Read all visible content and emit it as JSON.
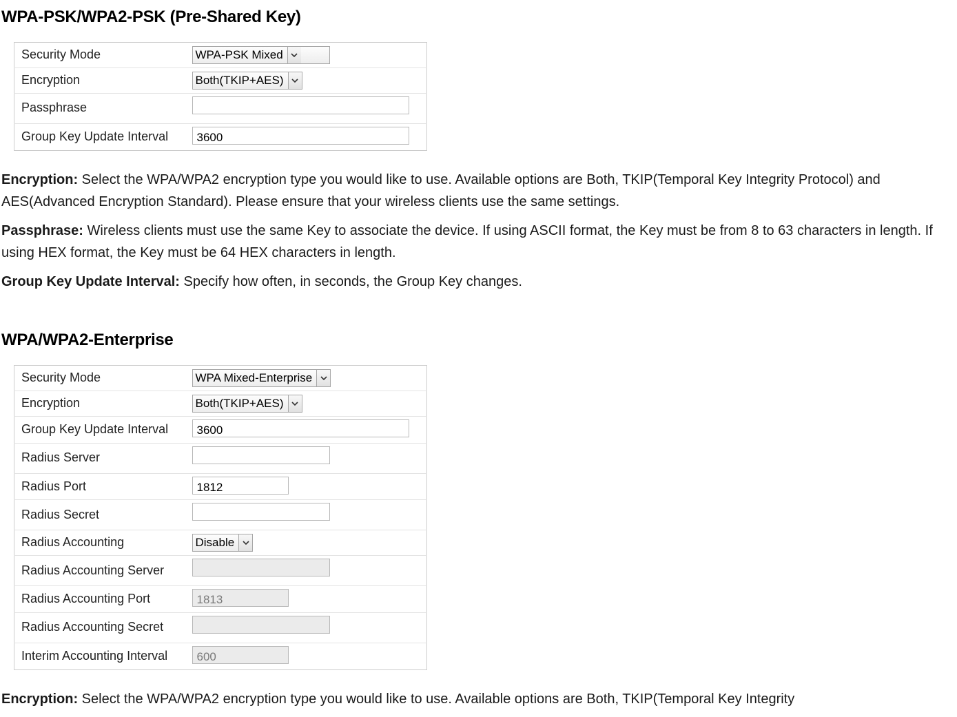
{
  "section1": {
    "heading": "WPA-PSK/WPA2-PSK (Pre-Shared Key)",
    "table": {
      "security_mode": {
        "label": "Security Mode",
        "value": "WPA-PSK Mixed"
      },
      "encryption": {
        "label": "Encryption",
        "value": "Both(TKIP+AES)"
      },
      "passphrase": {
        "label": "Passphrase",
        "value": ""
      },
      "group_key": {
        "label": "Group Key Update Interval",
        "value": "3600"
      }
    },
    "descriptions": {
      "encryption": {
        "term": "Encryption:",
        "text": " Select the WPA/WPA2 encryption type you would like to use. Available options are Both, TKIP(Temporal Key Integrity Protocol) and AES(Advanced Encryption Standard). Please ensure that your wireless clients use the same settings."
      },
      "passphrase": {
        "term": "Passphrase:",
        "text": " Wireless clients must use the same Key to associate the device. If using ASCII format, the Key must be from 8 to 63 characters in length. If using HEX format, the Key must be 64 HEX characters in length."
      },
      "group_key": {
        "term": "Group Key Update Interval:",
        "text": " Specify how often, in seconds, the Group Key changes."
      }
    }
  },
  "section2": {
    "heading": "WPA/WPA2-Enterprise",
    "table": {
      "security_mode": {
        "label": "Security Mode",
        "value": "WPA Mixed-Enterprise"
      },
      "encryption": {
        "label": "Encryption",
        "value": "Both(TKIP+AES)"
      },
      "group_key": {
        "label": "Group Key Update Interval",
        "value": "3600"
      },
      "radius_server": {
        "label": "Radius Server",
        "value": ""
      },
      "radius_port": {
        "label": "Radius Port",
        "value": "1812"
      },
      "radius_secret": {
        "label": "Radius Secret",
        "value": ""
      },
      "radius_accounting": {
        "label": "Radius Accounting",
        "value": "Disable"
      },
      "radius_accounting_server": {
        "label": "Radius Accounting Server",
        "value": ""
      },
      "radius_accounting_port": {
        "label": "Radius Accounting Port",
        "value": "1813"
      },
      "radius_accounting_secret": {
        "label": "Radius Accounting Secret",
        "value": ""
      },
      "interim_accounting_interval": {
        "label": "Interim Accounting Interval",
        "value": "600"
      }
    },
    "descriptions": {
      "encryption": {
        "term": "Encryption:",
        "text": " Select the WPA/WPA2 encryption type you would like to use. Available options are Both, TKIP(Temporal Key Integrity"
      }
    }
  }
}
